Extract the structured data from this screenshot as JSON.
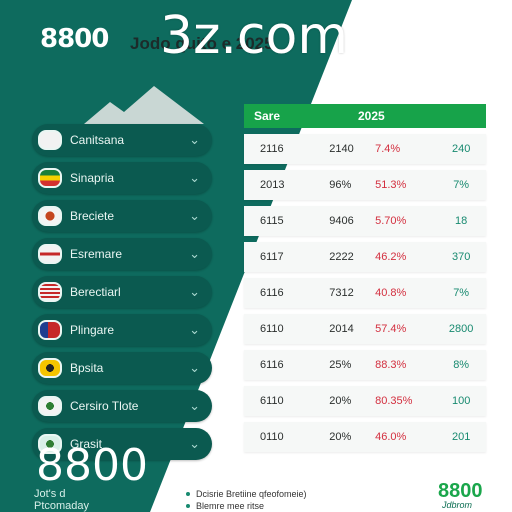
{
  "watermark": "3z.com",
  "header": {
    "brand": "8800",
    "headline": "Jodo quito e 2025"
  },
  "sidebar": {
    "items": [
      {
        "label": "Canitsana"
      },
      {
        "label": "Sinapria"
      },
      {
        "label": "Breciete"
      },
      {
        "label": "Esremare"
      },
      {
        "label": "Berectiarl"
      },
      {
        "label": "Plingare"
      },
      {
        "label": "Bpsita"
      },
      {
        "label": "Cersiro Tlote"
      },
      {
        "label": "Grasit"
      }
    ]
  },
  "table": {
    "headers": [
      "Sare",
      "2025"
    ],
    "rows": [
      {
        "c1": "2116",
        "c2": "2140",
        "c3": "7.4%",
        "c4": "240"
      },
      {
        "c1": "2013",
        "c2": "96%",
        "c3": "51.3%",
        "c4": "7%"
      },
      {
        "c1": "6115",
        "c2": "9406",
        "c3": "5.70%",
        "c4": "18"
      },
      {
        "c1": "6117",
        "c2": "2222",
        "c3": "46.2%",
        "c4": "370"
      },
      {
        "c1": "6116",
        "c2": "7312",
        "c3": "40.8%",
        "c4": "7%"
      },
      {
        "c1": "6110",
        "c2": "2014",
        "c3": "57.4%",
        "c4": "2800"
      },
      {
        "c1": "6116",
        "c2": "25%",
        "c3": "88.3%",
        "c4": "8%"
      },
      {
        "c1": "6110",
        "c2": "20%",
        "c3": "80.35%",
        "c4": "100"
      },
      {
        "c1": "0110",
        "c2": "20%",
        "c3": "46.0%",
        "c4": "201"
      }
    ]
  },
  "footer": {
    "big_number": "8800",
    "sub_line1": "Jot's d",
    "sub_line2": "Ptcomaday",
    "legend": [
      "Dcisrie Bretiine qfeofomeie)",
      "Blemre mee ritse"
    ],
    "logo": "8800",
    "logo_sub": "Jdbrom"
  },
  "colors": {
    "teal": "#0e6b5e",
    "dark_teal": "#0b5a50",
    "green_header": "#17a34a",
    "negative_red": "#d32f3f",
    "accent_green": "#188a70"
  },
  "icons": [
    "mountain-icon",
    "chevron-down-icon",
    "flag-icon"
  ]
}
